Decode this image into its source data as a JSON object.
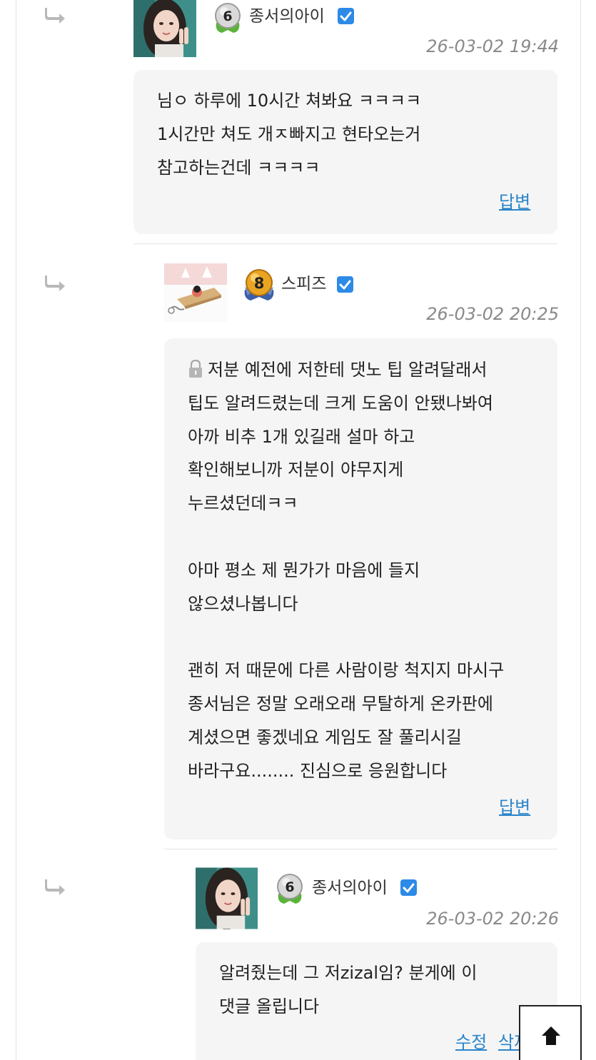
{
  "comments": [
    {
      "nickname": "종서의아이",
      "level": "6",
      "date": "26-03-02 19:44",
      "lines": [
        "님ㅇ 하루에 10시간 쳐봐요 ㅋㅋㅋㅋ",
        "1시간만 쳐도 개ㅈ빠지고 현타오는거",
        "참고하는건데 ㅋㅋㅋㅋ"
      ],
      "reply_label": "답변"
    },
    {
      "nickname": "스피즈",
      "level": "8",
      "date": "26-03-02 20:25",
      "lines": [
        "저분 예전에 저한테 댓노 팁 알려달래서",
        "팁도 알려드렸는데 크게 도움이 안됐나봐여",
        "아까 비추 1개 있길래 설마 하고",
        "확인해보니까 저분이 야무지게",
        "누르셨던데ㅋㅋ",
        "",
        "아마 평소 제 뭔가가 마음에 들지",
        "않으셨나봅니다",
        "",
        "괜히 저 때문에 다른 사람이랑 척지지 마시구",
        "종서님은 정말 오래오래 무탈하게 온카판에",
        "계셨으면 좋겠네요 게임도 잘 풀리시길",
        "바라구요........ 진심으로 응원합니다"
      ],
      "reply_label": "답변"
    },
    {
      "nickname": "종서의아이",
      "level": "6",
      "date": "26-03-02 20:26",
      "lines": [
        "알려줬는데 그 저zizal임? 분게에 이",
        "댓글 올립니다"
      ],
      "edit_label": "수정",
      "delete_label": "삭제"
    }
  ],
  "icons": {
    "reply": "reply-arrow-icon",
    "verified": "check-badge-icon",
    "secret": "lock-icon",
    "top": "arrow-up-icon"
  },
  "colors": {
    "link": "#2a84c9",
    "verified": "#2d8ae6",
    "bubble": "#f5f5f6",
    "date": "#8a8a8a"
  }
}
